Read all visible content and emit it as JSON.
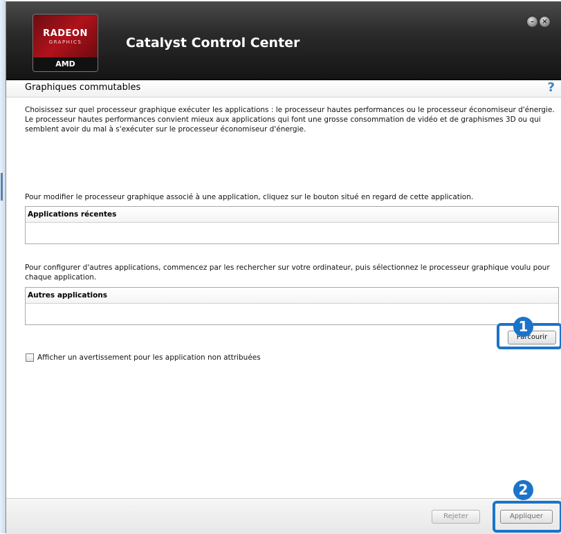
{
  "window": {
    "title": "Catalyst Control Center",
    "logo": {
      "brand": "RADEON",
      "sub": "GRAPHICS",
      "vendor": "AMD"
    },
    "controls": {
      "minimize": "–",
      "close": "×"
    }
  },
  "section": {
    "title": "Graphiques commutables",
    "help": "?"
  },
  "content": {
    "description": "Choisissez sur quel processeur graphique exécuter les applications : le processeur hautes performances ou le processeur économiseur d'énergie. Le processeur hautes performances convient mieux aux applications qui font une grosse consommation de vidéo et de graphismes 3D ou qui semblent avoir du mal à s'exécuter sur le processeur économiseur d'énergie.",
    "modify_text": "Pour modifier le processeur graphique associé à une application, cliquez sur le bouton situé en regard de cette application.",
    "recent_header": "Applications récentes",
    "configure_text": "Pour configurer d'autres applications, commencez par les rechercher sur votre ordinateur, puis sélectionnez le processeur graphique voulu pour chaque application.",
    "other_header": "Autres applications",
    "browse_button": "Parcourir",
    "warning_checkbox_label": "Afficher un avertissement pour les application non attribuées",
    "warning_checked": false
  },
  "footer": {
    "reject_button": "Rejeter",
    "apply_button": "Appliquer"
  },
  "annotations": {
    "step1": "1",
    "step2": "2",
    "highlight_color": "#1b74c9"
  }
}
